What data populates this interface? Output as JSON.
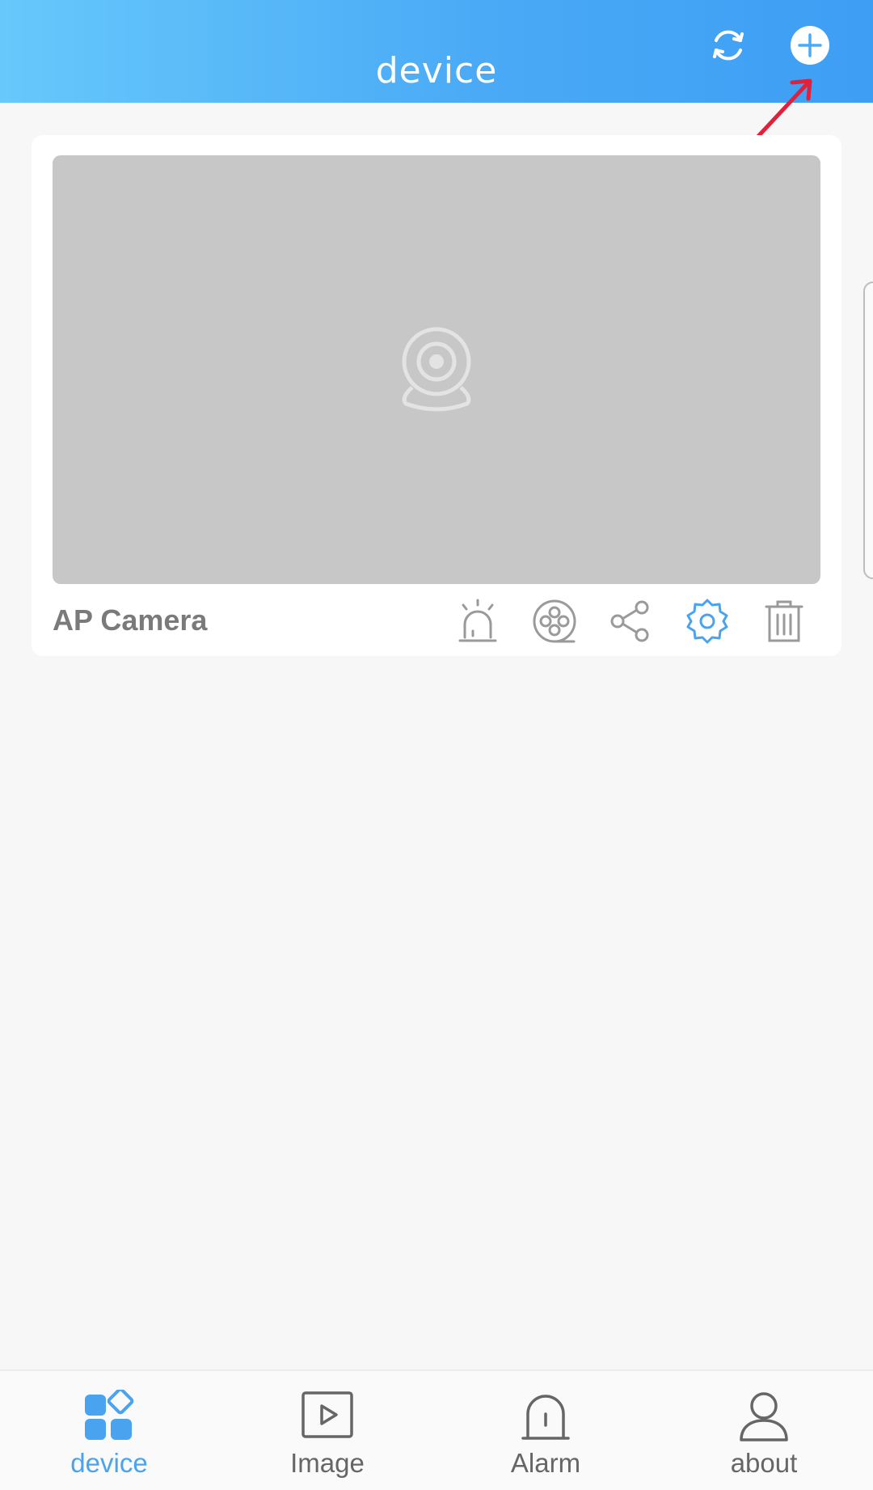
{
  "header": {
    "title": "device",
    "refresh_icon": "refresh-icon",
    "add_icon": "add-circle-icon"
  },
  "device_card": {
    "name": "AP Camera",
    "preview_icon": "webcam-placeholder-icon",
    "actions": [
      {
        "name": "alarm-button",
        "icon": "siren-icon"
      },
      {
        "name": "playback-button",
        "icon": "film-reel-icon"
      },
      {
        "name": "share-button",
        "icon": "share-icon"
      },
      {
        "name": "settings-button",
        "icon": "gear-icon"
      },
      {
        "name": "delete-button",
        "icon": "trash-icon"
      }
    ]
  },
  "bottom_nav": {
    "items": [
      {
        "label": "device",
        "icon": "device-grid-icon",
        "active": true
      },
      {
        "label": "Image",
        "icon": "play-square-icon",
        "active": false
      },
      {
        "label": "Alarm",
        "icon": "alarm-bell-icon",
        "active": false
      },
      {
        "label": "about",
        "icon": "user-icon",
        "active": false
      }
    ]
  },
  "colors": {
    "header_gradient_start": "#66c8fb",
    "header_gradient_end": "#3d9ef4",
    "accent": "#4aa3ef",
    "annotation_arrow": "#e0213c",
    "icon_gray": "#9a9a9a"
  }
}
